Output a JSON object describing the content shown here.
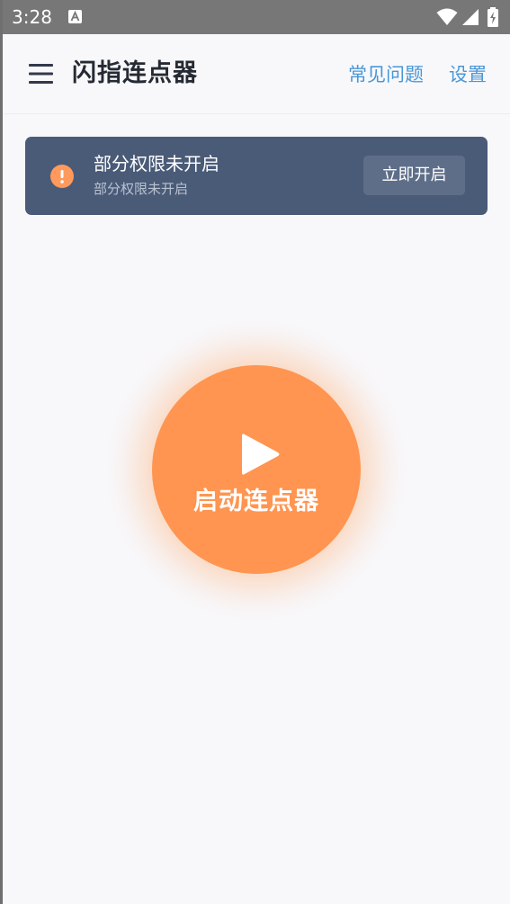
{
  "status_bar": {
    "time": "3:28",
    "icons": [
      "a-notification-icon",
      "wifi-icon",
      "signal-icon",
      "battery-icon"
    ]
  },
  "app_bar": {
    "menu_icon": "hamburger-menu-icon",
    "title": "闪指连点器",
    "faq_label": "常见问题",
    "settings_label": "设置"
  },
  "permission_banner": {
    "icon": "warning-icon",
    "title": "部分权限未开启",
    "subtitle": "部分权限未开启",
    "button_label": "立即开启"
  },
  "start": {
    "icon": "play-icon",
    "label": "启动连点器"
  },
  "colors": {
    "accent_orange": "#ff9550",
    "banner_background": "#4a5b78",
    "link_blue": "#4a97d6",
    "page_background": "#f8f8fb"
  }
}
